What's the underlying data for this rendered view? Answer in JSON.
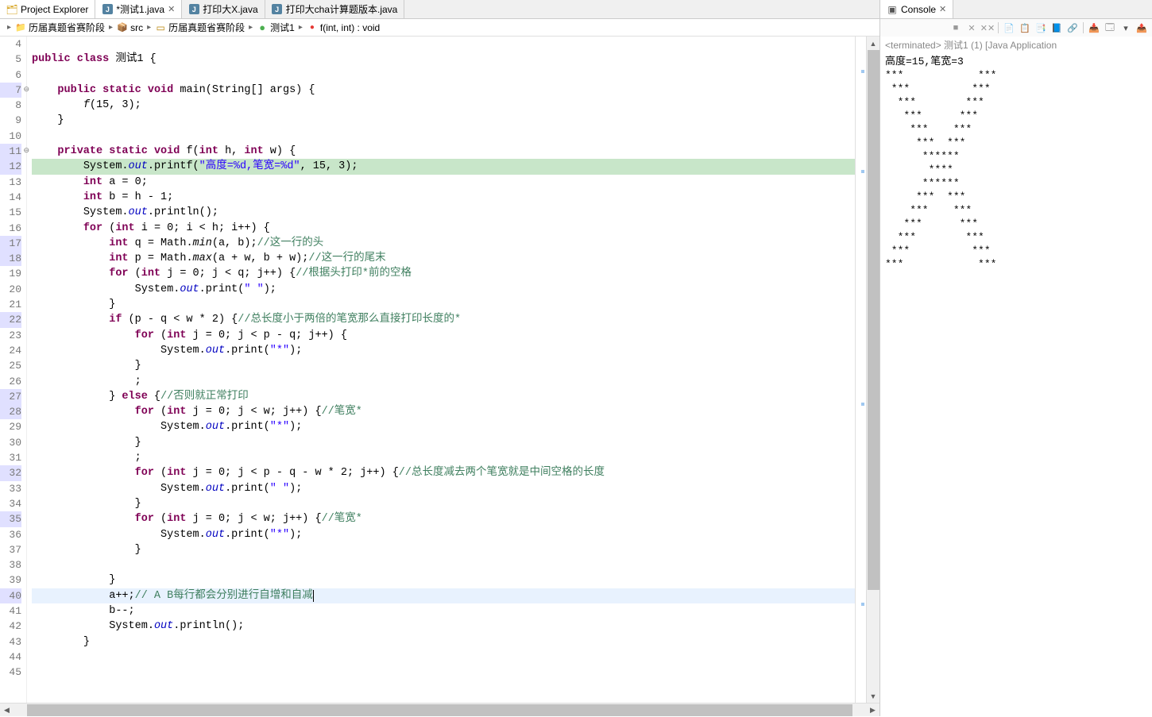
{
  "sideTab": {
    "label": "Project Explorer"
  },
  "editorTabs": [
    {
      "label": "*测试1.java",
      "active": true,
      "closable": true
    },
    {
      "label": "打印大X.java",
      "active": false,
      "closable": false
    },
    {
      "label": "打印大cha计算题版本.java",
      "active": false,
      "closable": false
    }
  ],
  "breadcrumb": [
    {
      "icon": "project",
      "label": "历届真题省赛阶段"
    },
    {
      "icon": "src",
      "label": "src"
    },
    {
      "icon": "package",
      "label": "历届真题省赛阶段"
    },
    {
      "icon": "class",
      "label": "测试1"
    },
    {
      "icon": "method",
      "label": "f(int, int) : void"
    }
  ],
  "gutter": {
    "start": 4,
    "end": 45,
    "highlighted": [
      7,
      11,
      12,
      17,
      18,
      22,
      27,
      28,
      32,
      35,
      40
    ],
    "foldable": [
      7,
      11
    ]
  },
  "code": {
    "lines": [
      {
        "n": 4,
        "tokens": []
      },
      {
        "n": 5,
        "tokens": [
          {
            "t": "kw",
            "v": "public"
          },
          {
            "t": "p",
            "v": " "
          },
          {
            "t": "kw",
            "v": "class"
          },
          {
            "t": "p",
            "v": " 测试1 {"
          }
        ]
      },
      {
        "n": 6,
        "tokens": []
      },
      {
        "n": 7,
        "indent": "    ",
        "tokens": [
          {
            "t": "kw",
            "v": "public"
          },
          {
            "t": "p",
            "v": " "
          },
          {
            "t": "kw",
            "v": "static"
          },
          {
            "t": "p",
            "v": " "
          },
          {
            "t": "kw",
            "v": "void"
          },
          {
            "t": "p",
            "v": " main(String[] args) {"
          }
        ]
      },
      {
        "n": 8,
        "indent": "        ",
        "tokens": [
          {
            "t": "mtd",
            "v": "f"
          },
          {
            "t": "p",
            "v": "(15, 3);"
          }
        ]
      },
      {
        "n": 9,
        "indent": "    ",
        "tokens": [
          {
            "t": "p",
            "v": "}"
          }
        ]
      },
      {
        "n": 10,
        "tokens": []
      },
      {
        "n": 11,
        "indent": "    ",
        "tokens": [
          {
            "t": "kw",
            "v": "private"
          },
          {
            "t": "p",
            "v": " "
          },
          {
            "t": "kw",
            "v": "static"
          },
          {
            "t": "p",
            "v": " "
          },
          {
            "t": "kw",
            "v": "void"
          },
          {
            "t": "p",
            "v": " f("
          },
          {
            "t": "kw",
            "v": "int"
          },
          {
            "t": "p",
            "v": " h, "
          },
          {
            "t": "kw",
            "v": "int"
          },
          {
            "t": "p",
            "v": " w) {"
          }
        ]
      },
      {
        "n": 12,
        "exec": true,
        "indent": "        ",
        "tokens": [
          {
            "t": "p",
            "v": "System."
          },
          {
            "t": "fld",
            "v": "out"
          },
          {
            "t": "p",
            "v": ".printf("
          },
          {
            "t": "str",
            "v": "\"高度=%d,笔宽=%d\""
          },
          {
            "t": "p",
            "v": ", 15, 3);"
          }
        ]
      },
      {
        "n": 13,
        "indent": "        ",
        "tokens": [
          {
            "t": "kw",
            "v": "int"
          },
          {
            "t": "p",
            "v": " a = 0;"
          }
        ]
      },
      {
        "n": 14,
        "indent": "        ",
        "tokens": [
          {
            "t": "kw",
            "v": "int"
          },
          {
            "t": "p",
            "v": " b = h - 1;"
          }
        ]
      },
      {
        "n": 15,
        "indent": "        ",
        "tokens": [
          {
            "t": "p",
            "v": "System."
          },
          {
            "t": "fld",
            "v": "out"
          },
          {
            "t": "p",
            "v": ".println();"
          }
        ]
      },
      {
        "n": 16,
        "indent": "        ",
        "tokens": [
          {
            "t": "kw",
            "v": "for"
          },
          {
            "t": "p",
            "v": " ("
          },
          {
            "t": "kw",
            "v": "int"
          },
          {
            "t": "p",
            "v": " i = 0; i < h; i++) {"
          }
        ]
      },
      {
        "n": 17,
        "indent": "            ",
        "tokens": [
          {
            "t": "kw",
            "v": "int"
          },
          {
            "t": "p",
            "v": " q = Math."
          },
          {
            "t": "mtd",
            "v": "min"
          },
          {
            "t": "p",
            "v": "(a, b);"
          },
          {
            "t": "cmt",
            "v": "//这一行的头"
          }
        ]
      },
      {
        "n": 18,
        "indent": "            ",
        "tokens": [
          {
            "t": "kw",
            "v": "int"
          },
          {
            "t": "p",
            "v": " p = Math."
          },
          {
            "t": "mtd",
            "v": "max"
          },
          {
            "t": "p",
            "v": "(a + w, b + w);"
          },
          {
            "t": "cmt",
            "v": "//这一行的尾末"
          }
        ]
      },
      {
        "n": 19,
        "indent": "            ",
        "tokens": [
          {
            "t": "kw",
            "v": "for"
          },
          {
            "t": "p",
            "v": " ("
          },
          {
            "t": "kw",
            "v": "int"
          },
          {
            "t": "p",
            "v": " j = 0; j < q; j++) {"
          },
          {
            "t": "cmt",
            "v": "//根据头打印*前的空格"
          }
        ]
      },
      {
        "n": 20,
        "indent": "                ",
        "tokens": [
          {
            "t": "p",
            "v": "System."
          },
          {
            "t": "fld",
            "v": "out"
          },
          {
            "t": "p",
            "v": ".print("
          },
          {
            "t": "str",
            "v": "\" \""
          },
          {
            "t": "p",
            "v": ");"
          }
        ]
      },
      {
        "n": 21,
        "indent": "            ",
        "tokens": [
          {
            "t": "p",
            "v": "}"
          }
        ]
      },
      {
        "n": 22,
        "indent": "            ",
        "tokens": [
          {
            "t": "kw",
            "v": "if"
          },
          {
            "t": "p",
            "v": " (p - q < w * 2) {"
          },
          {
            "t": "cmt",
            "v": "//总长度小于两倍的笔宽那么直接打印长度的*"
          }
        ]
      },
      {
        "n": 23,
        "indent": "                ",
        "tokens": [
          {
            "t": "kw",
            "v": "for"
          },
          {
            "t": "p",
            "v": " ("
          },
          {
            "t": "kw",
            "v": "int"
          },
          {
            "t": "p",
            "v": " j = 0; j < p - q; j++) {"
          }
        ]
      },
      {
        "n": 24,
        "indent": "                    ",
        "tokens": [
          {
            "t": "p",
            "v": "System."
          },
          {
            "t": "fld",
            "v": "out"
          },
          {
            "t": "p",
            "v": ".print("
          },
          {
            "t": "str",
            "v": "\"*\""
          },
          {
            "t": "p",
            "v": ");"
          }
        ]
      },
      {
        "n": 25,
        "indent": "                ",
        "tokens": [
          {
            "t": "p",
            "v": "}"
          }
        ]
      },
      {
        "n": 26,
        "indent": "                ",
        "tokens": [
          {
            "t": "p",
            "v": ";"
          }
        ]
      },
      {
        "n": 27,
        "indent": "            ",
        "tokens": [
          {
            "t": "p",
            "v": "} "
          },
          {
            "t": "kw",
            "v": "else"
          },
          {
            "t": "p",
            "v": " {"
          },
          {
            "t": "cmt",
            "v": "//否则就正常打印"
          }
        ]
      },
      {
        "n": 28,
        "indent": "                ",
        "tokens": [
          {
            "t": "kw",
            "v": "for"
          },
          {
            "t": "p",
            "v": " ("
          },
          {
            "t": "kw",
            "v": "int"
          },
          {
            "t": "p",
            "v": " j = 0; j < w; j++) {"
          },
          {
            "t": "cmt",
            "v": "//笔宽*"
          }
        ]
      },
      {
        "n": 29,
        "indent": "                    ",
        "tokens": [
          {
            "t": "p",
            "v": "System."
          },
          {
            "t": "fld",
            "v": "out"
          },
          {
            "t": "p",
            "v": ".print("
          },
          {
            "t": "str",
            "v": "\"*\""
          },
          {
            "t": "p",
            "v": ");"
          }
        ]
      },
      {
        "n": 30,
        "indent": "                ",
        "tokens": [
          {
            "t": "p",
            "v": "}"
          }
        ]
      },
      {
        "n": 31,
        "indent": "                ",
        "tokens": [
          {
            "t": "p",
            "v": ";"
          }
        ]
      },
      {
        "n": 32,
        "indent": "                ",
        "tokens": [
          {
            "t": "kw",
            "v": "for"
          },
          {
            "t": "p",
            "v": " ("
          },
          {
            "t": "kw",
            "v": "int"
          },
          {
            "t": "p",
            "v": " j = 0; j < p - q - w * 2; j++) {"
          },
          {
            "t": "cmt",
            "v": "//总长度减去两个笔宽就是中间空格的长度"
          }
        ]
      },
      {
        "n": 33,
        "indent": "                    ",
        "tokens": [
          {
            "t": "p",
            "v": "System."
          },
          {
            "t": "fld",
            "v": "out"
          },
          {
            "t": "p",
            "v": ".print("
          },
          {
            "t": "str",
            "v": "\" \""
          },
          {
            "t": "p",
            "v": ");"
          }
        ]
      },
      {
        "n": 34,
        "indent": "                ",
        "tokens": [
          {
            "t": "p",
            "v": "}"
          }
        ]
      },
      {
        "n": 35,
        "indent": "                ",
        "tokens": [
          {
            "t": "kw",
            "v": "for"
          },
          {
            "t": "p",
            "v": " ("
          },
          {
            "t": "kw",
            "v": "int"
          },
          {
            "t": "p",
            "v": " j = 0; j < w; j++) {"
          },
          {
            "t": "cmt",
            "v": "//笔宽*"
          }
        ]
      },
      {
        "n": 36,
        "indent": "                    ",
        "tokens": [
          {
            "t": "p",
            "v": "System."
          },
          {
            "t": "fld",
            "v": "out"
          },
          {
            "t": "p",
            "v": ".print("
          },
          {
            "t": "str",
            "v": "\"*\""
          },
          {
            "t": "p",
            "v": ");"
          }
        ]
      },
      {
        "n": 37,
        "indent": "                ",
        "tokens": [
          {
            "t": "p",
            "v": "}"
          }
        ]
      },
      {
        "n": 38,
        "tokens": []
      },
      {
        "n": 39,
        "indent": "            ",
        "tokens": [
          {
            "t": "p",
            "v": "}"
          }
        ]
      },
      {
        "n": 40,
        "cursor": true,
        "indent": "            ",
        "tokens": [
          {
            "t": "p",
            "v": "a++;"
          },
          {
            "t": "cmt",
            "v": "// A B每行都会分别进行自增和自减"
          }
        ],
        "caret": true
      },
      {
        "n": 41,
        "indent": "            ",
        "tokens": [
          {
            "t": "p",
            "v": "b--;"
          }
        ]
      },
      {
        "n": 42,
        "indent": "            ",
        "tokens": [
          {
            "t": "p",
            "v": "System."
          },
          {
            "t": "fld",
            "v": "out"
          },
          {
            "t": "p",
            "v": ".println();"
          }
        ]
      },
      {
        "n": 43,
        "indent": "        ",
        "tokens": [
          {
            "t": "p",
            "v": "}"
          }
        ]
      },
      {
        "n": 44,
        "tokens": []
      }
    ]
  },
  "console": {
    "title": "Console",
    "header": "<terminated> 测试1 (1) [Java Application",
    "output": "高度=15,笔宽=3\n***            ***\n ***          ***\n  ***        ***\n   ***      ***\n    ***    ***\n     ***  ***\n      ******\n       ****\n      ******\n     ***  ***\n    ***    ***\n   ***      ***\n  ***        ***\n ***          ***\n***            ***"
  },
  "toolbarButtons": [
    "■",
    "✕",
    "✕✕",
    "│",
    "📄",
    "📋",
    "📑",
    "📘",
    "🔗",
    "│",
    "📥",
    "🗔",
    "▾",
    "📤"
  ]
}
